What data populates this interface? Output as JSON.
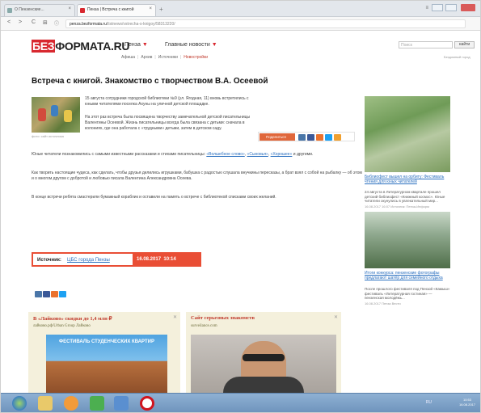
{
  "browser": {
    "tabs": [
      {
        "label": "О Пензенские...",
        "active": false
      },
      {
        "label": "Пенза | Встреча с книгой",
        "active": true
      }
    ],
    "new_tab": "+",
    "url_host": "penza.bezformata.ru",
    "url_path": "/listnews/vstrecha-s-knigoy/58313220/",
    "back": "<",
    "forward": ">",
    "reload": "C"
  },
  "site": {
    "logo_red": "БЕЗ",
    "logo_rest": "ФОРМАТА.RU",
    "nav_city": "Пенза",
    "nav_news": "Главные новости",
    "subnav": [
      "Афиша",
      "Архив",
      "Источники",
      "Новостройки"
    ],
    "search_placeholder": "Поиск",
    "search_button": "найти",
    "right_link": "Бездомный город"
  },
  "article": {
    "title": "Встреча с книгой. Знакомство с творчеством В.А. Осеевой",
    "photo_caption": "фото: сайт источника",
    "para1": "15 августа сотрудники городской библиотеки №9 (ул. Ягодная, 11) вновь встретились с юными читателями поселка Ахуны на уличной детской площадке.",
    "para2": "На этот раз встреча была посвящена творчеству замечательной детской писательницы Валентины Осеевой. Жизнь писательницы всегда была связана с детьми: сначала в колониях, где она работала с «трудными» детьми, затем в детском саду.",
    "para3_start": "Юные читатели познакомились с самыми известными рассказами и стихами писательницы:",
    "para3_links": [
      "«Волшебное слово»",
      "«Сыновья»",
      "«Хорошее»"
    ],
    "para3_end": "и другими.",
    "para4": "Как творить настоящие чудеса, как сделать, чтобы друзья делились игрушками, бабушка с радостью слушала внучкины пересказы, а брат взял с собой на рыбалку — об этом и о многом другом с добротой и любовью писала Валентина Александровна Осеева.",
    "para5": "В конце встречи ребята смастерили бумажный кораблик и оставили на память о встрече с библиотекой списками своих желаний.",
    "share_label": "Поделиться"
  },
  "source": {
    "label": "Источник:",
    "link": "ЦБС города Пензы",
    "date": "16.08.2017",
    "time": "10:14"
  },
  "ads": [
    {
      "title": "В «Лайково» скидки до 1,4 млн ₽",
      "sub": "лайково.рф/Urban Group Лайково",
      "banner": "ФЕСТИВАЛЬ СТУДЕНЧЕСКИХ КВАРТИР"
    },
    {
      "title": "Сайт серьезных знакомств",
      "sub": "surveilance.com"
    }
  ],
  "sidebar": [
    {
      "link": "Библиофест вышел на орбиту: Фестиваль чтения для юных читателей",
      "text": "24 августа в Литературном квартале прошел детский библиофест «Книжный космос». Юные читатели окунулись в увлекательный мир...",
      "date": "16.08.2017 16:07 Источник: Пенза-Информ"
    },
    {
      "link": "Итоги конкурса: пензенские фотографы предлагают шатёр для семейного отдыха",
      "text": "После прошлого фестиваля под Пензой «Камыш» фестиваль «Литературная гостиная» — пензенская молодёжь...",
      "date": "16.08.2017 Пенза Вести"
    }
  ],
  "taskbar": {
    "clock_time": "10:53",
    "clock_date": "16.08.2017",
    "lang": "RU"
  },
  "colors": {
    "brand_red": "#d8282f",
    "source_orange": "#e94e35",
    "link_blue": "#2a6fbf",
    "ad_bg": "#f4f0dc"
  }
}
